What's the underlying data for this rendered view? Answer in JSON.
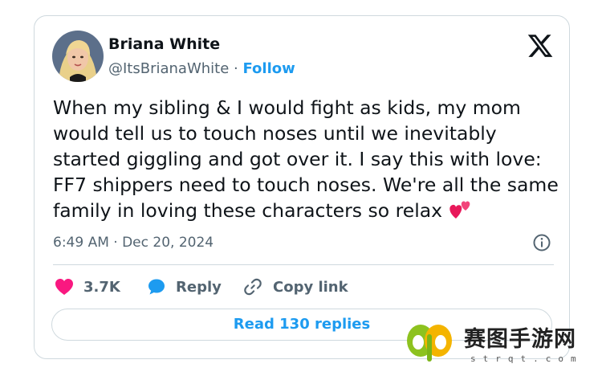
{
  "author": {
    "name": "Briana White",
    "handle": "@ItsBrianaWhite",
    "separator": " · ",
    "follow_label": "Follow"
  },
  "tweet": {
    "text": "When my sibling & I would fight as kids, my mom would tell us to touch noses until we inevitably started giggling and got over it. I say this with love: FF7 shippers need to touch noses. We're all the same family in loving these characters so relax",
    "emoji": "two-hearts",
    "timestamp": "6:49 AM · Dec 20, 2024"
  },
  "actions": {
    "like_count": "3.7K",
    "reply_label": "Reply",
    "copy_link_label": "Copy link"
  },
  "read_replies_label": "Read 130 replies",
  "watermark": {
    "text": "赛图手游网",
    "sub": "strqt.com"
  },
  "colors": {
    "accent": "#1d9bf0",
    "like": "#f91880",
    "text": "#0f1419",
    "secondary": "#536471",
    "border": "#cfd9de"
  },
  "icons": [
    "x-logo-icon",
    "info-icon",
    "heart-icon",
    "reply-bubble-icon",
    "link-icon",
    "butterfly-logo-icon"
  ]
}
